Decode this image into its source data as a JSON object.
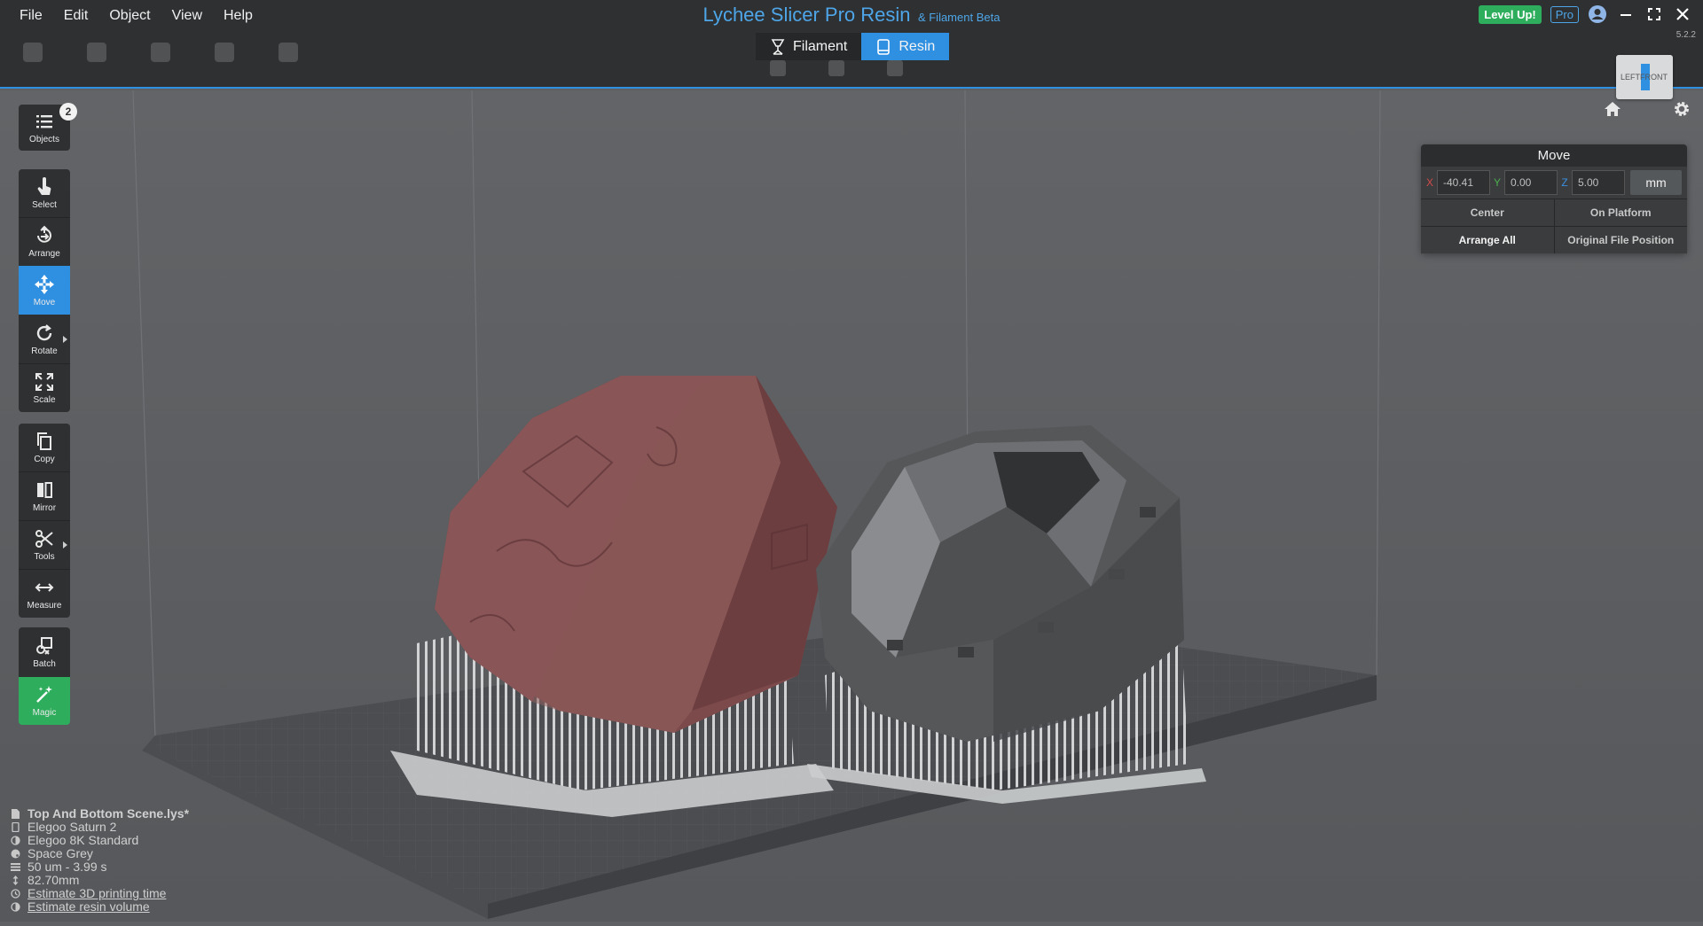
{
  "menu": [
    "File",
    "Edit",
    "Object",
    "View",
    "Help"
  ],
  "title": {
    "main": "Lychee Slicer Pro Resin",
    "sub": "& Filament Beta"
  },
  "modes": {
    "filament": "Filament",
    "resin": "Resin",
    "active": "resin"
  },
  "topright": {
    "level_up": "Level Up!",
    "pro": "Pro",
    "version": "5.2.2"
  },
  "viewcube": {
    "left": "LEFT",
    "front": "FRONT"
  },
  "sidebar": {
    "objects_label": "Objects",
    "objects_count": "2",
    "tools": [
      {
        "id": "select",
        "label": "Select"
      },
      {
        "id": "arrange",
        "label": "Arrange"
      },
      {
        "id": "move",
        "label": "Move"
      },
      {
        "id": "rotate",
        "label": "Rotate"
      },
      {
        "id": "scale",
        "label": "Scale"
      },
      {
        "id": "copy",
        "label": "Copy"
      },
      {
        "id": "mirror",
        "label": "Mirror"
      },
      {
        "id": "tools",
        "label": "Tools"
      },
      {
        "id": "measure",
        "label": "Measure"
      },
      {
        "id": "batch",
        "label": "Batch"
      },
      {
        "id": "magic",
        "label": "Magic"
      }
    ]
  },
  "move_panel": {
    "title": "Move",
    "x_label": "X",
    "x_value": "-40.41",
    "y_label": "Y",
    "y_value": "0.00",
    "z_label": "Z",
    "z_value": "5.00",
    "unit": "mm",
    "center": "Center",
    "on_platform": "On Platform",
    "arrange_all": "Arrange All",
    "original_position": "Original File Position"
  },
  "info": {
    "scene": "Top And Bottom Scene.lys*",
    "printer": "Elegoo Saturn 2",
    "resin": "Elegoo 8K Standard",
    "color": "Space Grey",
    "layer": "50 um - 3.99 s",
    "height": "82.70mm",
    "estimate_time": "Estimate 3D printing time",
    "estimate_volume": "Estimate resin volume"
  },
  "colors": {
    "accent": "#2f8fe0",
    "success": "#2eae5c",
    "topbar": "#2e3032",
    "viewport": "#5e6063"
  }
}
